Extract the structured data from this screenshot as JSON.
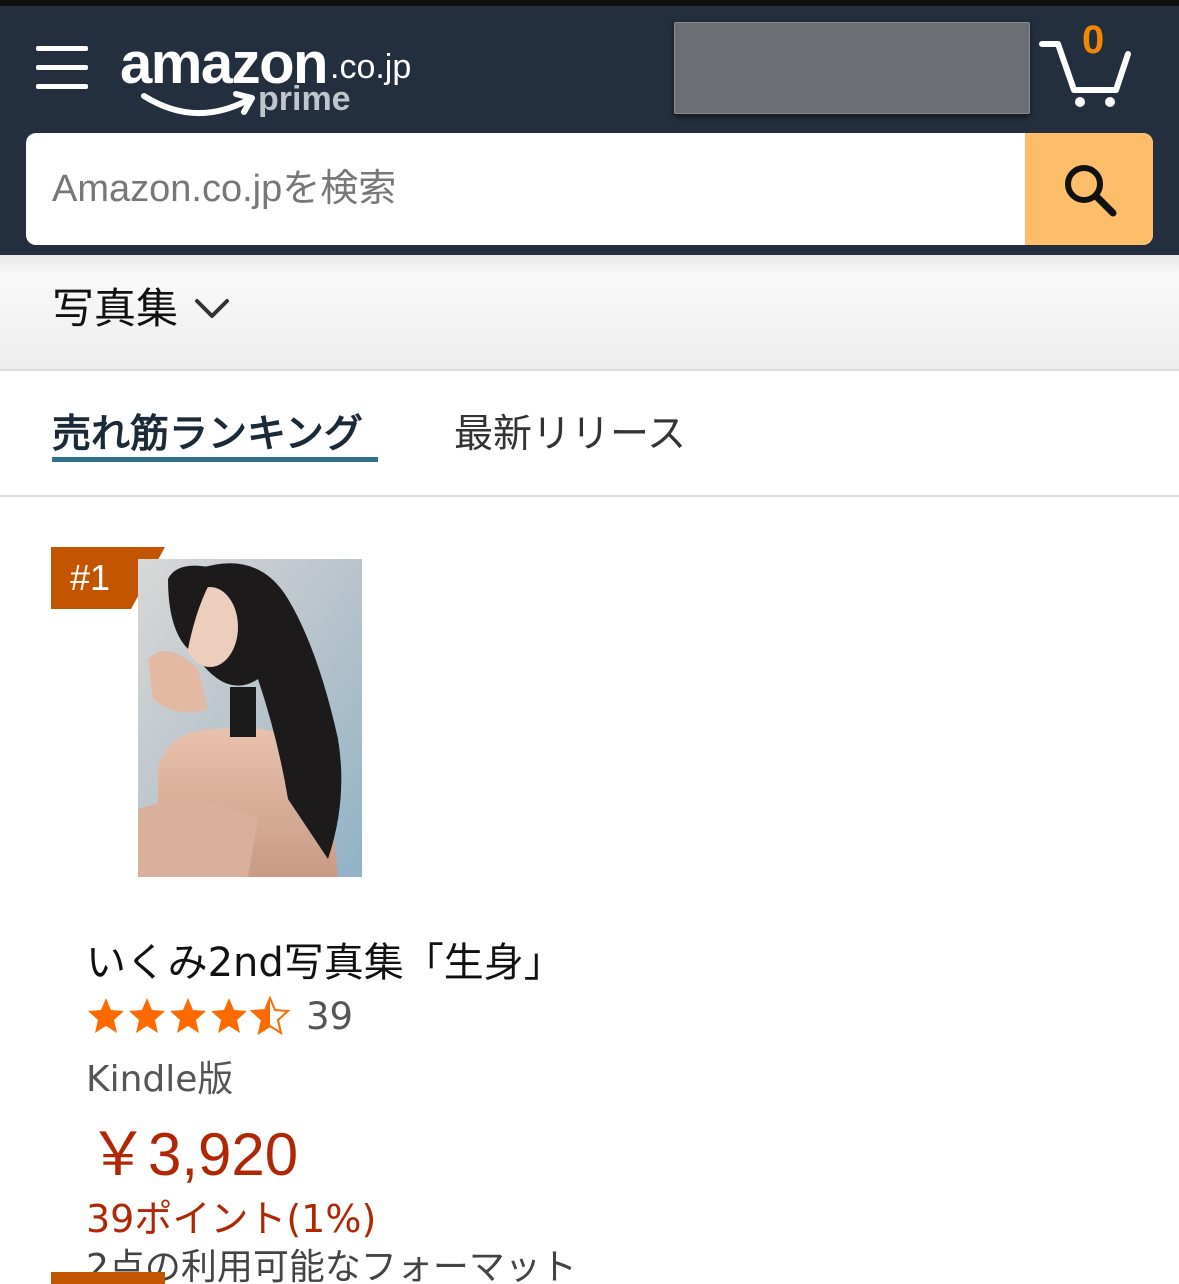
{
  "header": {
    "logo_word": "amazon",
    "logo_tld": ".co.jp",
    "logo_prime": "prime",
    "cart_count": "0"
  },
  "search": {
    "placeholder": "Amazon.co.jpを検索"
  },
  "category": {
    "label": "写真集"
  },
  "tabs": [
    {
      "label": "売れ筋ランキング",
      "selected": true
    },
    {
      "label": "最新リリース",
      "selected": false
    }
  ],
  "item": {
    "rank": "#1",
    "title": "いくみ2nd写真集「生身」",
    "rating": 4.5,
    "rating_count": "39",
    "format": "Kindle版",
    "price": "￥3,920",
    "points": "39ポイント(1%)",
    "formats_available": "2点の利用可能なフォーマット"
  },
  "colors": {
    "header_bg": "#232f3e",
    "search_button": "#febd69",
    "rank_badge": "#c45500",
    "price_red": "#b12704",
    "star": "#ff6a00",
    "tab_underline": "#2f6f8c"
  }
}
